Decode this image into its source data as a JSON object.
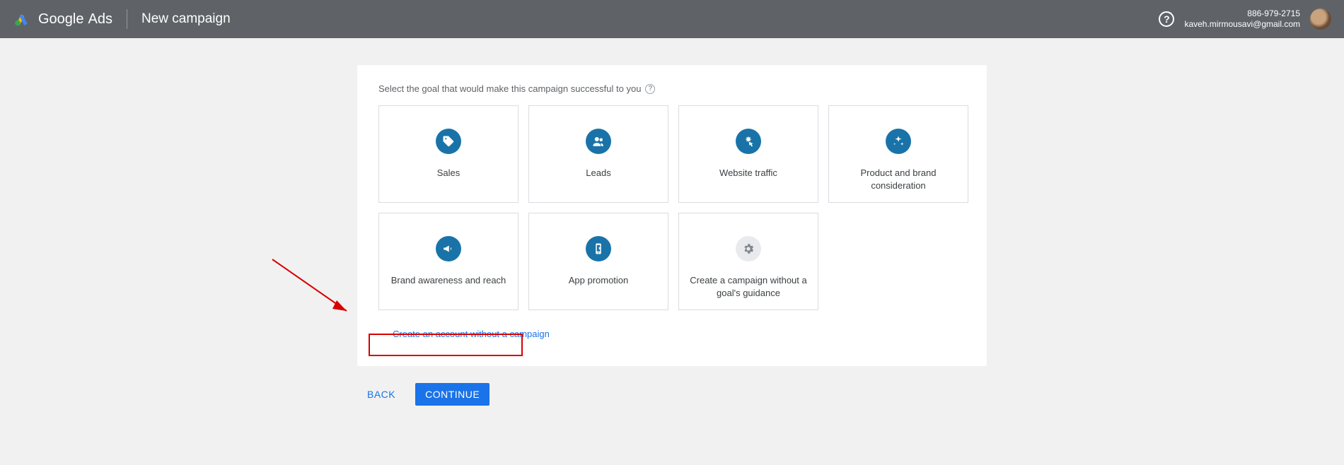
{
  "header": {
    "brand_first": "Google",
    "brand_second": "Ads",
    "page_title": "New campaign",
    "account_id": "886-979-2715",
    "account_email": "kaveh.mirmousavi@gmail.com"
  },
  "main": {
    "prompt": "Select the goal that would make this campaign successful to you",
    "goals": [
      {
        "label": "Sales",
        "icon": "tag"
      },
      {
        "label": "Leads",
        "icon": "people"
      },
      {
        "label": "Website traffic",
        "icon": "click"
      },
      {
        "label": "Product and brand consideration",
        "icon": "sparkle"
      },
      {
        "label": "Brand awareness and reach",
        "icon": "megaphone"
      },
      {
        "label": "App promotion",
        "icon": "phone"
      },
      {
        "label": "Create a campaign without a goal's guidance",
        "icon": "gear",
        "gray": true
      }
    ],
    "alt_link": "Create an account without a campaign"
  },
  "buttons": {
    "back": "BACK",
    "cont": "CONTINUE"
  }
}
